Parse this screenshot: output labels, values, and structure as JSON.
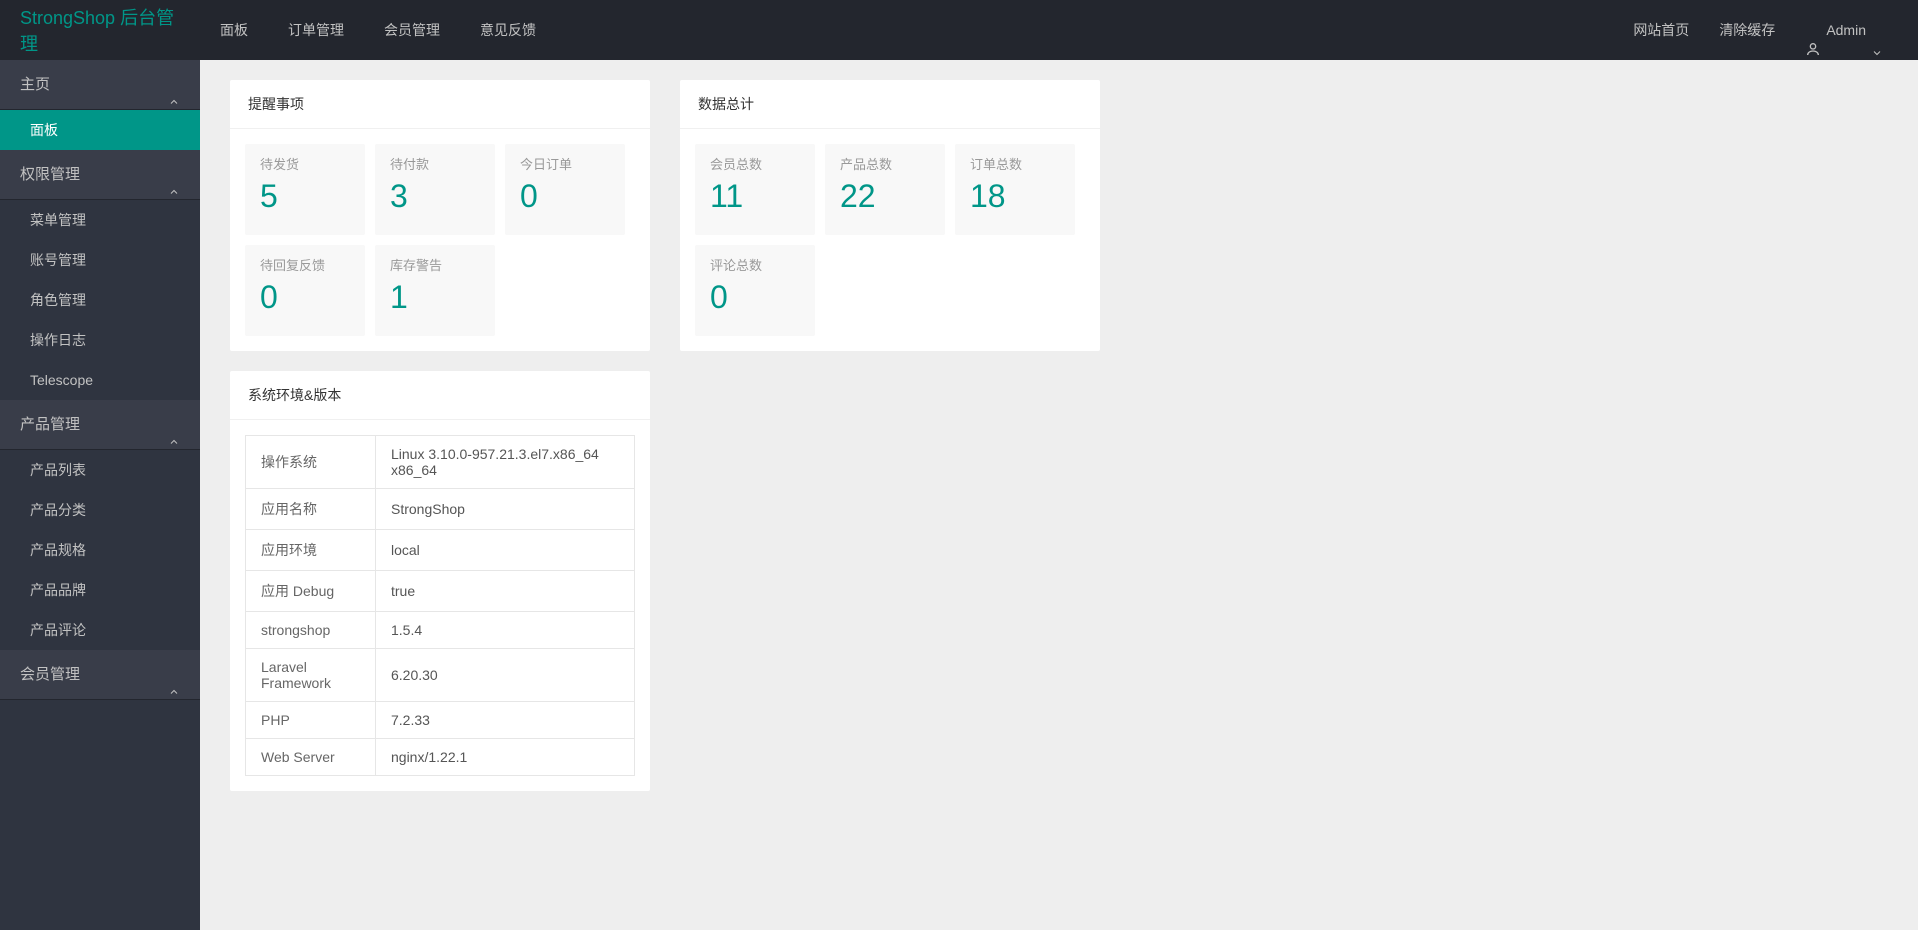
{
  "header": {
    "logo": "StrongShop 后台管理",
    "nav": [
      {
        "label": "面板"
      },
      {
        "label": "订单管理"
      },
      {
        "label": "会员管理"
      },
      {
        "label": "意见反馈"
      }
    ],
    "right": {
      "home": "网站首页",
      "clear_cache": "清除缓存",
      "admin": "Admin"
    }
  },
  "sidebar": {
    "groups": [
      {
        "title": "主页",
        "items": [
          {
            "label": "面板",
            "active": true
          }
        ]
      },
      {
        "title": "权限管理",
        "items": [
          {
            "label": "菜单管理"
          },
          {
            "label": "账号管理"
          },
          {
            "label": "角色管理"
          },
          {
            "label": "操作日志"
          },
          {
            "label": "Telescope"
          }
        ]
      },
      {
        "title": "产品管理",
        "items": [
          {
            "label": "产品列表"
          },
          {
            "label": "产品分类"
          },
          {
            "label": "产品规格"
          },
          {
            "label": "产品品牌"
          },
          {
            "label": "产品评论"
          }
        ]
      },
      {
        "title": "会员管理",
        "items": []
      }
    ]
  },
  "reminders": {
    "title": "提醒事项",
    "items": [
      {
        "label": "待发货",
        "value": "5"
      },
      {
        "label": "待付款",
        "value": "3"
      },
      {
        "label": "今日订单",
        "value": "0"
      },
      {
        "label": "待回复反馈",
        "value": "0"
      },
      {
        "label": "库存警告",
        "value": "1"
      }
    ]
  },
  "totals": {
    "title": "数据总计",
    "items": [
      {
        "label": "会员总数",
        "value": "11"
      },
      {
        "label": "产品总数",
        "value": "22"
      },
      {
        "label": "订单总数",
        "value": "18"
      },
      {
        "label": "评论总数",
        "value": "0"
      }
    ]
  },
  "env": {
    "title": "系统环境&版本",
    "rows": [
      {
        "k": "操作系统",
        "v": "Linux 3.10.0-957.21.3.el7.x86_64 x86_64"
      },
      {
        "k": "应用名称",
        "v": "StrongShop"
      },
      {
        "k": "应用环境",
        "v": "local"
      },
      {
        "k": "应用 Debug",
        "v": "true"
      },
      {
        "k": "strongshop",
        "v": "1.5.4"
      },
      {
        "k": "Laravel Framework",
        "v": "6.20.30"
      },
      {
        "k": "PHP",
        "v": "7.2.33"
      },
      {
        "k": "Web Server",
        "v": "nginx/1.22.1"
      }
    ]
  }
}
